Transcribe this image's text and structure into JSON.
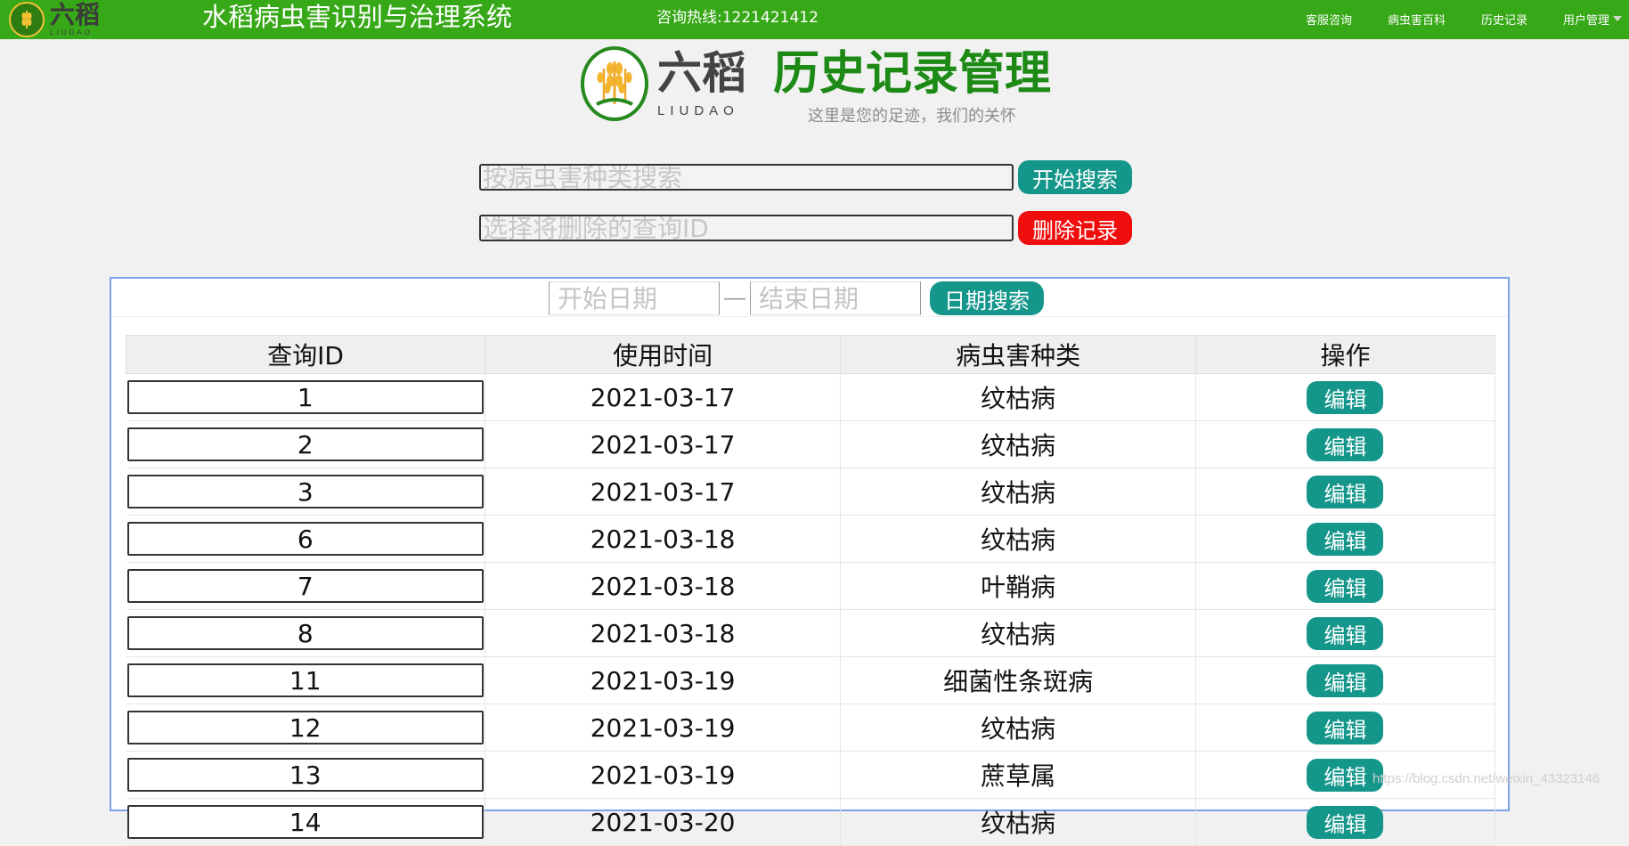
{
  "topbar": {
    "logo_cn": "六稻",
    "logo_en": "LIUDAO",
    "system_title": "水稻病虫害识别与治理系统",
    "hotline": "咨询热线:1221421412",
    "nav": [
      "客服咨询",
      "病虫害百科",
      "历史记录",
      "用户管理"
    ]
  },
  "header": {
    "logo_cn": "六稻",
    "logo_en": "LIUDAO",
    "title": "历史记录管理",
    "subtitle": "这里是您的足迹，我们的关怀"
  },
  "search": {
    "placeholder": "按病虫害种类搜索",
    "button": "开始搜索"
  },
  "delete": {
    "placeholder": "选择将删除的查询ID",
    "button": "删除记录"
  },
  "date_filter": {
    "start_placeholder": "开始日期",
    "separator": "—",
    "end_placeholder": "结束日期",
    "button": "日期搜索"
  },
  "table": {
    "headers": [
      "查询ID",
      "使用时间",
      "病虫害种类",
      "操作"
    ],
    "rows": [
      {
        "id": "1",
        "date": "2021-03-17",
        "type": "纹枯病",
        "action": "编辑"
      },
      {
        "id": "2",
        "date": "2021-03-17",
        "type": "纹枯病",
        "action": "编辑"
      },
      {
        "id": "3",
        "date": "2021-03-17",
        "type": "纹枯病",
        "action": "编辑"
      },
      {
        "id": "6",
        "date": "2021-03-18",
        "type": "纹枯病",
        "action": "编辑"
      },
      {
        "id": "7",
        "date": "2021-03-18",
        "type": "叶鞘病",
        "action": "编辑"
      },
      {
        "id": "8",
        "date": "2021-03-18",
        "type": "纹枯病",
        "action": "编辑"
      },
      {
        "id": "11",
        "date": "2021-03-19",
        "type": "细菌性条斑病",
        "action": "编辑"
      },
      {
        "id": "12",
        "date": "2021-03-19",
        "type": "纹枯病",
        "action": "编辑"
      },
      {
        "id": "13",
        "date": "2021-03-19",
        "type": "蔗草属",
        "action": "编辑"
      },
      {
        "id": "14",
        "date": "2021-03-20",
        "type": "纹枯病",
        "action": "编辑"
      }
    ]
  },
  "watermark": "https://blog.csdn.net/weixin_43323146",
  "colors": {
    "topbar": "#37a817",
    "title_green": "#1c8a15",
    "teal_button": "#14968a",
    "red_button": "#f00d0d",
    "panel_border": "#7fa2e6"
  }
}
